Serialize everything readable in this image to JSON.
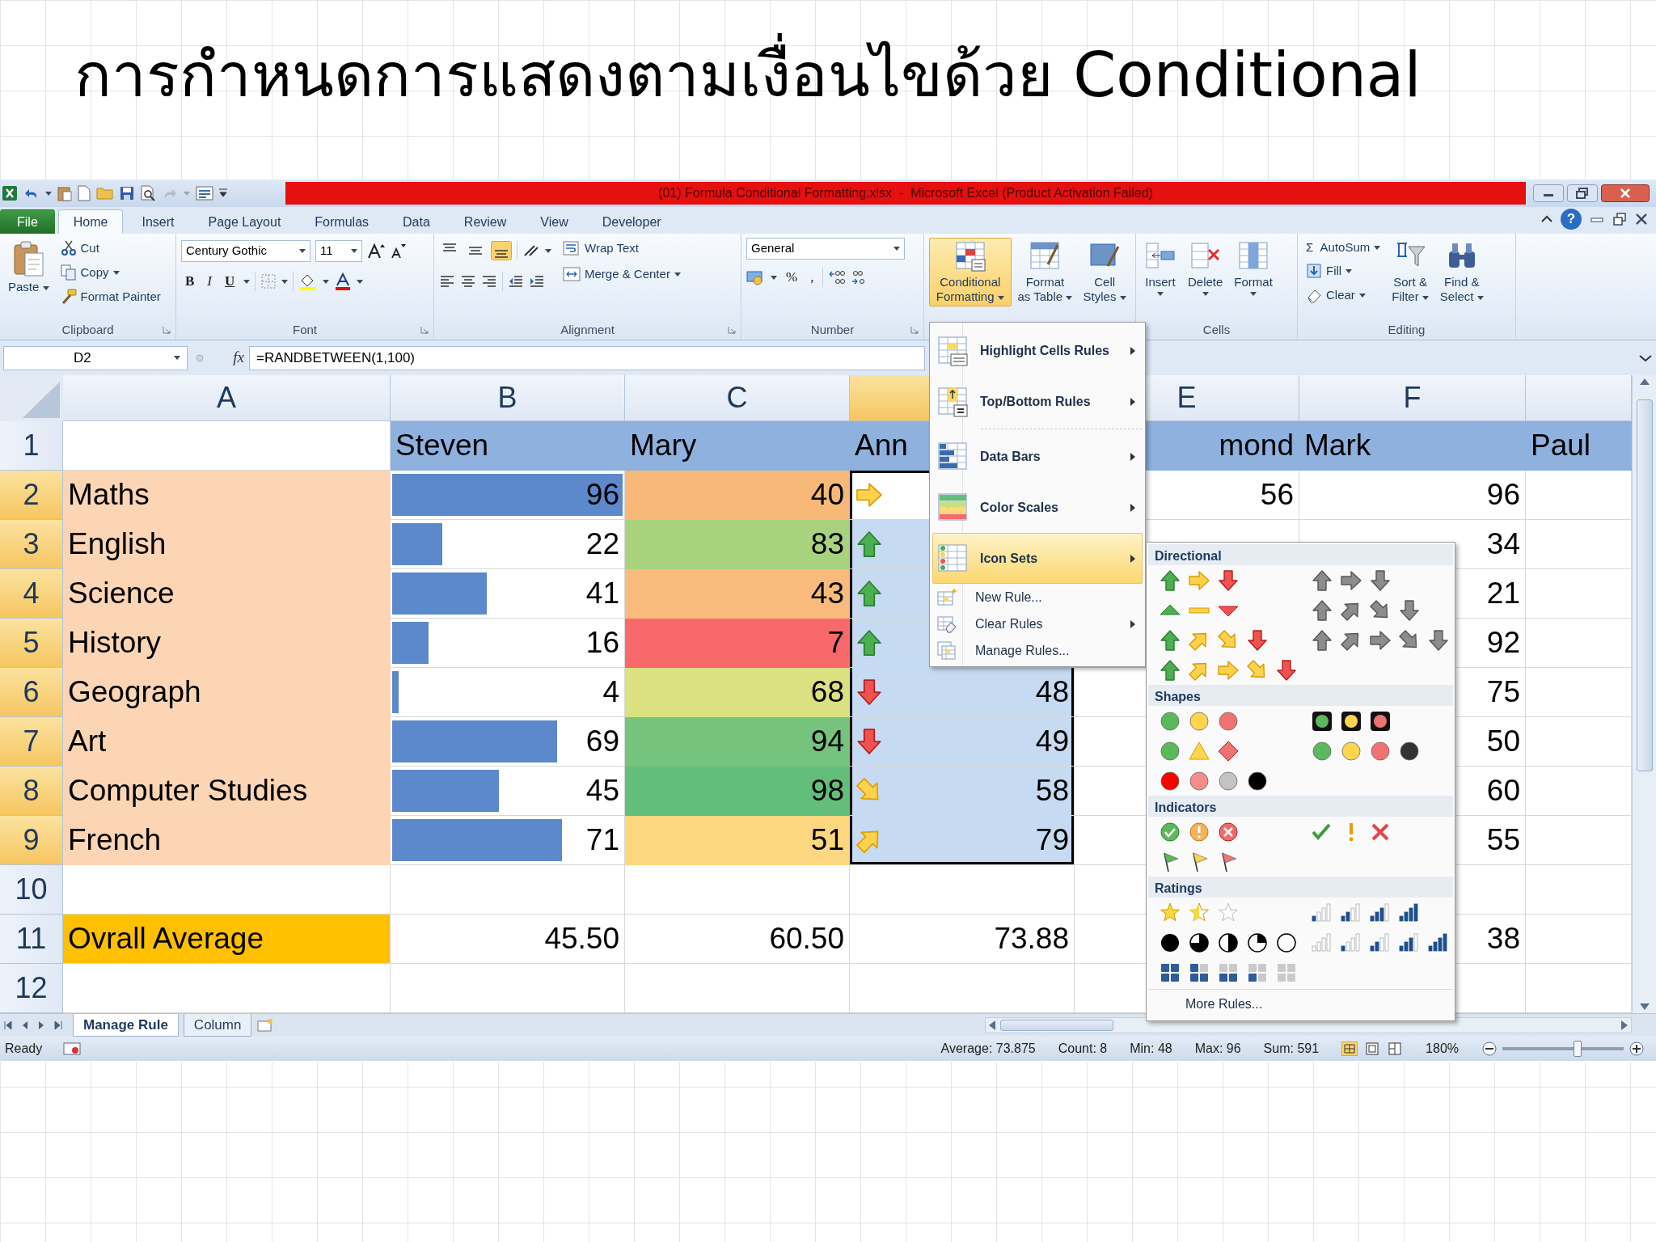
{
  "slide": {
    "title": "การกำหนดการแสดงตามเงื่อนไขด้วย Conditional"
  },
  "window": {
    "title": "(01) Formula Conditional Formatting.xlsx  -  Microsoft Excel (Product Activation Failed)",
    "help": "?"
  },
  "ribbon_tabs": [
    {
      "label": "File",
      "kind": "file",
      "selected": false
    },
    {
      "label": "Home",
      "kind": "tab",
      "selected": true
    },
    {
      "label": "Insert",
      "kind": "tab",
      "selected": false
    },
    {
      "label": "Page Layout",
      "kind": "tab",
      "selected": false
    },
    {
      "label": "Formulas",
      "kind": "tab",
      "selected": false
    },
    {
      "label": "Data",
      "kind": "tab",
      "selected": false
    },
    {
      "label": "Review",
      "kind": "tab",
      "selected": false
    },
    {
      "label": "View",
      "kind": "tab",
      "selected": false
    },
    {
      "label": "Developer",
      "kind": "tab",
      "selected": false
    }
  ],
  "ribbon": {
    "clipboard": {
      "label": "Clipboard",
      "paste": "Paste",
      "cut": "Cut",
      "copy": "Copy",
      "format_painter": "Format Painter"
    },
    "font": {
      "label": "Font",
      "font_name": "Century Gothic",
      "font_size": "11",
      "bold": "B",
      "italic": "I",
      "underline": "U"
    },
    "alignment": {
      "label": "Alignment",
      "vertical_align": [
        {
          "selected": false
        },
        {
          "selected": false
        },
        {
          "selected": true
        }
      ],
      "wrap_text": "Wrap Text",
      "merge_center": "Merge & Center"
    },
    "number": {
      "label": "Number",
      "format": "General",
      "percent": "%",
      "comma": ","
    },
    "styles": {
      "conditional_formatting": {
        "label": "Conditional\nFormatting",
        "open": true
      },
      "format_as_table": "Format\nas Table",
      "cell_styles": "Cell\nStyles"
    },
    "cells": {
      "label": "Cells",
      "insert": "Insert",
      "delete": "Delete",
      "format": "Format"
    },
    "editing": {
      "label": "Editing",
      "autosum_symbol": "Σ",
      "autosum": "AutoSum",
      "fill": "Fill",
      "clear": "Clear",
      "sort_filter": "Sort &\nFilter",
      "find_select": "Find &\nSelect"
    }
  },
  "formula_bar": {
    "name_box": "D2",
    "fx": "fx",
    "formula": "=RANDBETWEEN(1,100)"
  },
  "sheet": {
    "columns": [
      {
        "label": "A",
        "selected": false
      },
      {
        "label": "B",
        "selected": false
      },
      {
        "label": "C",
        "selected": false
      },
      {
        "selected": true
      },
      {
        "label": "E",
        "selected": false
      },
      {
        "label": "F",
        "selected": false
      },
      {
        "selected": false
      }
    ],
    "rows": [
      {
        "header": "1",
        "selected": false,
        "cells": [
          {},
          {
            "text": "Steven",
            "kind": "name"
          },
          {
            "text": "Mary",
            "kind": "name"
          },
          {
            "text": "Ann",
            "kind": "name"
          },
          {
            "text": "mond",
            "kind": "name_tail"
          },
          {
            "text": "Mark",
            "kind": "name"
          },
          {
            "text": "Paul",
            "kind": "name"
          }
        ]
      },
      {
        "header": "2",
        "selected": true,
        "cells": [
          {
            "text": "Maths",
            "kind": "subject"
          },
          {
            "text": "96",
            "kind": "bar",
            "level": 1
          },
          {
            "text": "40",
            "kind": "scale",
            "color": "#f8b878"
          },
          {
            "kind": "arrow_right",
            "selected": true,
            "active": true
          },
          {
            "text": "56"
          },
          {
            "text": "96"
          },
          {}
        ]
      },
      {
        "header": "3",
        "selected": true,
        "cells": [
          {
            "text": "English",
            "kind": "subject"
          },
          {
            "text": "22",
            "kind": "bar",
            "level": 0.23
          },
          {
            "text": "83",
            "kind": "scale",
            "color": "#a9d27f"
          },
          {
            "kind": "arrow_up",
            "selected": true,
            "active": false
          },
          {},
          {
            "text": "34"
          },
          {}
        ]
      },
      {
        "header": "4",
        "selected": true,
        "cells": [
          {
            "text": "Science",
            "kind": "subject"
          },
          {
            "text": "41",
            "kind": "bar",
            "level": 0.42
          },
          {
            "text": "43",
            "kind": "scale",
            "color": "#f9bb7b"
          },
          {
            "kind": "arrow_up",
            "selected": true,
            "active": false
          },
          {},
          {
            "text": "21"
          },
          {}
        ]
      },
      {
        "header": "5",
        "selected": true,
        "cells": [
          {
            "text": "History",
            "kind": "subject"
          },
          {
            "text": "16",
            "kind": "bar",
            "level": 0.17
          },
          {
            "text": "7",
            "kind": "scale",
            "color": "#f8696b"
          },
          {
            "kind": "arrow_up",
            "selected": true,
            "active": false
          },
          {},
          {
            "text": "92"
          },
          {}
        ]
      },
      {
        "header": "6",
        "selected": true,
        "cells": [
          {
            "text": "Geograph",
            "kind": "subject"
          },
          {
            "text": "4",
            "kind": "bar",
            "level": 0.04
          },
          {
            "text": "68",
            "kind": "scale",
            "color": "#dbe081"
          },
          {
            "text": "48",
            "kind": "arrow_down",
            "selected": true,
            "active": false
          },
          {},
          {
            "text": "75"
          },
          {}
        ]
      },
      {
        "header": "7",
        "selected": true,
        "cells": [
          {
            "text": "Art",
            "kind": "subject"
          },
          {
            "text": "69",
            "kind": "bar",
            "level": 0.72
          },
          {
            "text": "94",
            "kind": "scale",
            "color": "#76c37d"
          },
          {
            "text": "49",
            "kind": "arrow_down",
            "selected": true,
            "active": false
          },
          {},
          {
            "text": "50"
          },
          {}
        ]
      },
      {
        "header": "8",
        "selected": true,
        "cells": [
          {
            "text": "Computer Studies",
            "kind": "subject"
          },
          {
            "text": "45",
            "kind": "bar",
            "level": 0.47
          },
          {
            "text": "98",
            "kind": "scale",
            "color": "#63be7b"
          },
          {
            "text": "58",
            "kind": "arrow_down_right",
            "selected": true,
            "active": false
          },
          {},
          {
            "text": "60"
          },
          {}
        ]
      },
      {
        "header": "9",
        "selected": true,
        "cells": [
          {
            "text": "French",
            "kind": "subject"
          },
          {
            "text": "71",
            "kind": "bar",
            "level": 0.74
          },
          {
            "text": "51",
            "kind": "scale",
            "color": "#fdd680"
          },
          {
            "text": "79",
            "kind": "arrow_up_right",
            "selected": true,
            "active": false
          },
          {},
          {
            "text": "55"
          },
          {}
        ]
      },
      {
        "header": "10",
        "selected": false,
        "cells": [
          {},
          {},
          {},
          {},
          {},
          {},
          {}
        ]
      },
      {
        "header": "11",
        "selected": false,
        "cells": [
          {
            "text": "Ovrall Average",
            "kind": "average"
          },
          {
            "text": "45.50"
          },
          {
            "text": "60.50"
          },
          {
            "text": "73.88"
          },
          {},
          {
            "text": "38"
          },
          {}
        ]
      },
      {
        "header": "12",
        "selected": false,
        "cells": [
          {},
          {},
          {},
          {},
          {},
          {},
          {}
        ]
      }
    ]
  },
  "sheet_tabs": [
    {
      "label": "Manage Rule",
      "selected": true
    },
    {
      "label": "Column",
      "selected": false
    }
  ],
  "status_bar": {
    "ready": "Ready",
    "stats": [
      "Average: 73.875",
      "Count: 8",
      "Min: 48",
      "Max: 96",
      "Sum: 591"
    ],
    "zoom": "180%",
    "zoom_slider": {
      "level": 0.62
    }
  },
  "menu": {
    "items": [
      {
        "label": "Highlight Cells Rules",
        "kind": "large",
        "submenu": true,
        "selected": false
      },
      {
        "label": "Top/Bottom Rules",
        "kind": "large",
        "submenu": true,
        "selected": false
      },
      {
        "label": "Data Bars",
        "kind": "large",
        "submenu": true,
        "selected": false,
        "separator_before": true
      },
      {
        "label": "Color Scales",
        "kind": "large",
        "submenu": true,
        "selected": false
      },
      {
        "label": "Icon Sets",
        "kind": "large",
        "submenu": true,
        "selected": true
      },
      {
        "label": "New Rule...",
        "kind": "small",
        "submenu": false,
        "selected": false
      },
      {
        "label": "Clear Rules",
        "kind": "small",
        "submenu": true,
        "selected": false
      },
      {
        "label": "Manage Rules...",
        "kind": "small",
        "submenu": false,
        "selected": false
      }
    ]
  },
  "submenu": {
    "sections": [
      {
        "title": "Directional",
        "kind": "directional"
      },
      {
        "title": "Shapes",
        "kind": "shapes"
      },
      {
        "title": "Indicators",
        "kind": "indicators"
      },
      {
        "title": "Ratings",
        "kind": "ratings"
      }
    ],
    "footer": "More Rules..."
  }
}
